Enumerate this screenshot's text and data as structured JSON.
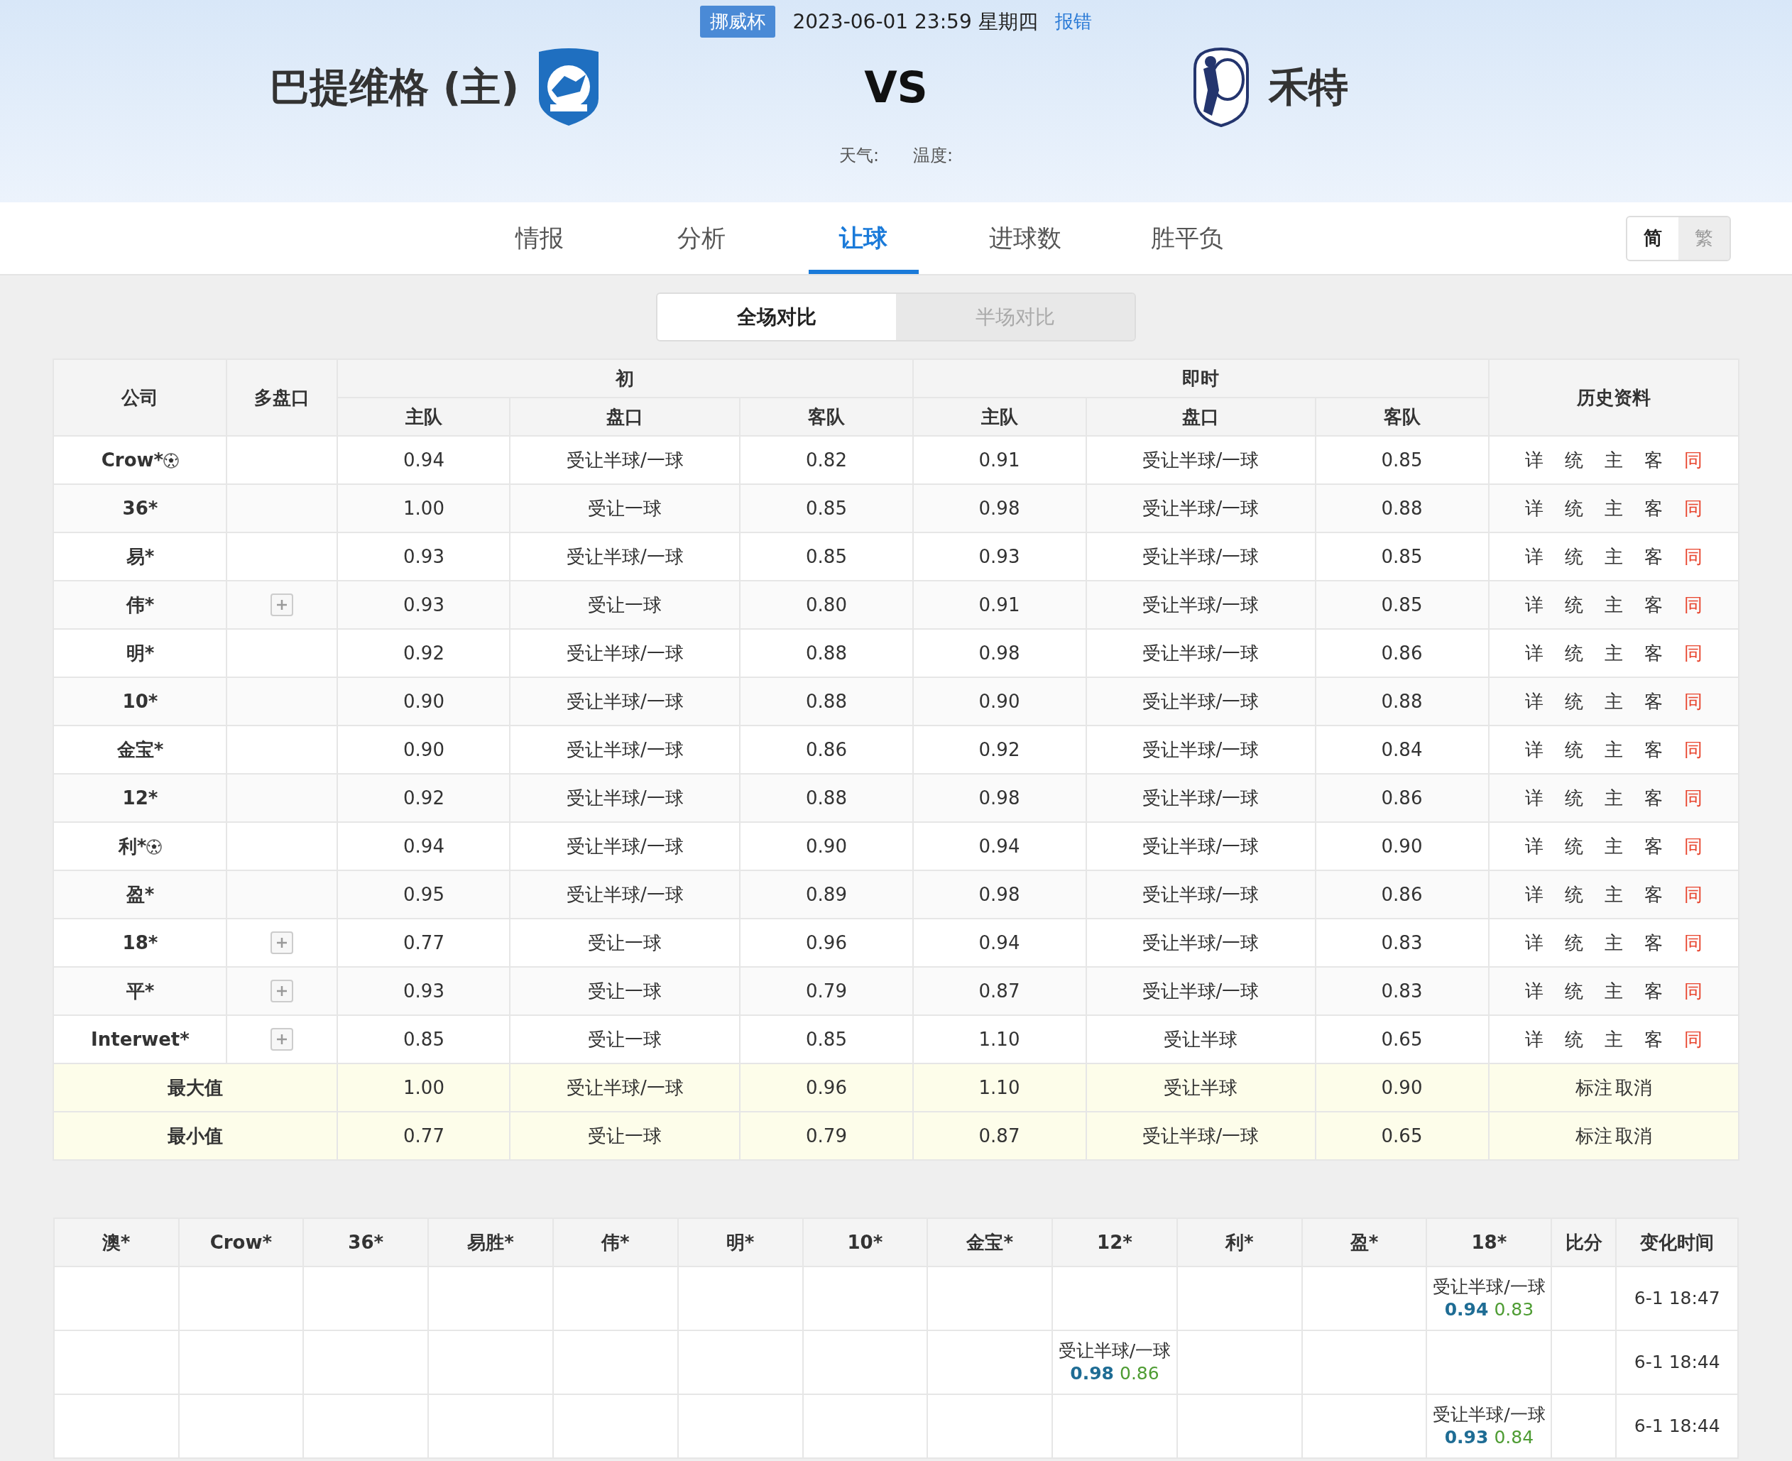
{
  "match": {
    "competition": "挪威杯",
    "datetime": "2023-06-01 23:59 星期四",
    "report_link": "报错",
    "home_team": "巴提维格 (主)",
    "vs": "VS",
    "away_team": "禾特",
    "weather_label": "天气:",
    "temperature_label": "温度:"
  },
  "tabs": [
    {
      "label": "情报",
      "selected": false
    },
    {
      "label": "分析",
      "selected": false
    },
    {
      "label": "让球",
      "selected": true
    },
    {
      "label": "进球数",
      "selected": false
    },
    {
      "label": "胜平负",
      "selected": false
    }
  ],
  "script_toggle": [
    {
      "label": "简",
      "selected": true
    },
    {
      "label": "繁",
      "selected": false
    }
  ],
  "compare_toggle": [
    {
      "label": "全场对比",
      "selected": true
    },
    {
      "label": "半场对比",
      "selected": false
    }
  ],
  "odds_table": {
    "company_header": "公司",
    "multi_header": "多盘口",
    "initial_header": "初",
    "live_header": "即时",
    "history_header": "历史资料",
    "sub_headers": [
      "主队",
      "盘口",
      "客队",
      "主队",
      "盘口",
      "客队"
    ],
    "rows": [
      {
        "company": "Crow*",
        "ball_icon": true,
        "multi_line": false,
        "initial": [
          "0.94",
          "受让半球/一球",
          "0.82"
        ],
        "live": [
          "0.91",
          "受让半球/一球",
          "0.85"
        ],
        "history": [
          {
            "label": "详",
            "color": "#333333"
          },
          {
            "label": "统",
            "color": "#333333"
          },
          {
            "label": "主",
            "color": "#333333"
          },
          {
            "label": "客",
            "color": "#333333"
          },
          {
            "label": "同",
            "color": "#e8462f"
          }
        ]
      },
      {
        "company": "36*",
        "ball_icon": false,
        "multi_line": false,
        "initial": [
          "1.00",
          "受让一球",
          "0.85"
        ],
        "live": [
          "0.98",
          "受让半球/一球",
          "0.88"
        ],
        "history": [
          {
            "label": "详",
            "color": "#333333"
          },
          {
            "label": "统",
            "color": "#333333"
          },
          {
            "label": "主",
            "color": "#333333"
          },
          {
            "label": "客",
            "color": "#333333"
          },
          {
            "label": "同",
            "color": "#e8462f"
          }
        ]
      },
      {
        "company": "易*",
        "ball_icon": false,
        "multi_line": false,
        "initial": [
          "0.93",
          "受让半球/一球",
          "0.85"
        ],
        "live": [
          "0.93",
          "受让半球/一球",
          "0.85"
        ],
        "history": [
          {
            "label": "详",
            "color": "#333333"
          },
          {
            "label": "统",
            "color": "#333333"
          },
          {
            "label": "主",
            "color": "#333333"
          },
          {
            "label": "客",
            "color": "#333333"
          },
          {
            "label": "同",
            "color": "#e8462f"
          }
        ]
      },
      {
        "company": "伟*",
        "ball_icon": false,
        "multi_line": true,
        "initial": [
          "0.93",
          "受让一球",
          "0.80"
        ],
        "live": [
          "0.91",
          "受让半球/一球",
          "0.85"
        ],
        "history": [
          {
            "label": "详",
            "color": "#333333"
          },
          {
            "label": "统",
            "color": "#333333"
          },
          {
            "label": "主",
            "color": "#333333"
          },
          {
            "label": "客",
            "color": "#333333"
          },
          {
            "label": "同",
            "color": "#e8462f"
          }
        ]
      },
      {
        "company": "明*",
        "ball_icon": false,
        "multi_line": false,
        "initial": [
          "0.92",
          "受让半球/一球",
          "0.88"
        ],
        "live": [
          "0.98",
          "受让半球/一球",
          "0.86"
        ],
        "history": [
          {
            "label": "详",
            "color": "#333333"
          },
          {
            "label": "统",
            "color": "#333333"
          },
          {
            "label": "主",
            "color": "#333333"
          },
          {
            "label": "客",
            "color": "#333333"
          },
          {
            "label": "同",
            "color": "#e8462f"
          }
        ]
      },
      {
        "company": "10*",
        "ball_icon": false,
        "multi_line": false,
        "initial": [
          "0.90",
          "受让半球/一球",
          "0.88"
        ],
        "live": [
          "0.90",
          "受让半球/一球",
          "0.88"
        ],
        "history": [
          {
            "label": "详",
            "color": "#333333"
          },
          {
            "label": "统",
            "color": "#333333"
          },
          {
            "label": "主",
            "color": "#333333"
          },
          {
            "label": "客",
            "color": "#333333"
          },
          {
            "label": "同",
            "color": "#e8462f"
          }
        ]
      },
      {
        "company": "金宝*",
        "ball_icon": false,
        "multi_line": false,
        "initial": [
          "0.90",
          "受让半球/一球",
          "0.86"
        ],
        "live": [
          "0.92",
          "受让半球/一球",
          "0.84"
        ],
        "history": [
          {
            "label": "详",
            "color": "#333333"
          },
          {
            "label": "统",
            "color": "#333333"
          },
          {
            "label": "主",
            "color": "#333333"
          },
          {
            "label": "客",
            "color": "#333333"
          },
          {
            "label": "同",
            "color": "#e8462f"
          }
        ]
      },
      {
        "company": "12*",
        "ball_icon": false,
        "multi_line": false,
        "initial": [
          "0.92",
          "受让半球/一球",
          "0.88"
        ],
        "live": [
          "0.98",
          "受让半球/一球",
          "0.86"
        ],
        "history": [
          {
            "label": "详",
            "color": "#333333"
          },
          {
            "label": "统",
            "color": "#333333"
          },
          {
            "label": "主",
            "color": "#333333"
          },
          {
            "label": "客",
            "color": "#333333"
          },
          {
            "label": "同",
            "color": "#e8462f"
          }
        ]
      },
      {
        "company": "利*",
        "ball_icon": true,
        "multi_line": false,
        "initial": [
          "0.94",
          "受让半球/一球",
          "0.90"
        ],
        "live": [
          "0.94",
          "受让半球/一球",
          "0.90"
        ],
        "history": [
          {
            "label": "详",
            "color": "#333333"
          },
          {
            "label": "统",
            "color": "#333333"
          },
          {
            "label": "主",
            "color": "#333333"
          },
          {
            "label": "客",
            "color": "#333333"
          },
          {
            "label": "同",
            "color": "#e8462f"
          }
        ]
      },
      {
        "company": "盈*",
        "ball_icon": false,
        "multi_line": false,
        "initial": [
          "0.95",
          "受让半球/一球",
          "0.89"
        ],
        "live": [
          "0.98",
          "受让半球/一球",
          "0.86"
        ],
        "history": [
          {
            "label": "详",
            "color": "#333333"
          },
          {
            "label": "统",
            "color": "#333333"
          },
          {
            "label": "主",
            "color": "#333333"
          },
          {
            "label": "客",
            "color": "#333333"
          },
          {
            "label": "同",
            "color": "#e8462f"
          }
        ]
      },
      {
        "company": "18*",
        "ball_icon": false,
        "multi_line": true,
        "initial": [
          "0.77",
          "受让一球",
          "0.96"
        ],
        "live": [
          "0.94",
          "受让半球/一球",
          "0.83"
        ],
        "history": [
          {
            "label": "详",
            "color": "#333333"
          },
          {
            "label": "统",
            "color": "#333333"
          },
          {
            "label": "主",
            "color": "#333333"
          },
          {
            "label": "客",
            "color": "#333333"
          },
          {
            "label": "同",
            "color": "#e8462f"
          }
        ]
      },
      {
        "company": "平*",
        "ball_icon": false,
        "multi_line": true,
        "initial": [
          "0.93",
          "受让一球",
          "0.79"
        ],
        "live": [
          "0.87",
          "受让半球/一球",
          "0.83"
        ],
        "history": [
          {
            "label": "详",
            "color": "#333333"
          },
          {
            "label": "统",
            "color": "#333333"
          },
          {
            "label": "主",
            "color": "#333333"
          },
          {
            "label": "客",
            "color": "#333333"
          },
          {
            "label": "同",
            "color": "#e8462f"
          }
        ]
      },
      {
        "company": "Interwet*",
        "ball_icon": false,
        "multi_line": true,
        "initial": [
          "0.85",
          "受让一球",
          "0.85"
        ],
        "live": [
          "1.10",
          "受让半球",
          "0.65"
        ],
        "history": [
          {
            "label": "详",
            "color": "#333333"
          },
          {
            "label": "统",
            "color": "#333333"
          },
          {
            "label": "主",
            "color": "#333333"
          },
          {
            "label": "客",
            "color": "#333333"
          },
          {
            "label": "同",
            "color": "#e8462f"
          }
        ]
      }
    ],
    "summary_rows": [
      {
        "label": "最大值",
        "initial": [
          "1.00",
          "受让半球/一球",
          "0.96"
        ],
        "live": [
          "1.10",
          "受让半球",
          "0.90"
        ],
        "actions": [
          "标注",
          "取消"
        ]
      },
      {
        "label": "最小值",
        "initial": [
          "0.77",
          "受让一球",
          "0.79"
        ],
        "live": [
          "0.87",
          "受让半球/一球",
          "0.65"
        ],
        "actions": [
          "标注",
          "取消"
        ]
      }
    ]
  },
  "changes_table": {
    "columns": [
      "澳*",
      "Crow*",
      "36*",
      "易胜*",
      "伟*",
      "明*",
      "10*",
      "金宝*",
      "12*",
      "利*",
      "盈*",
      "18*",
      "比分",
      "变化时间"
    ],
    "rows": [
      {
        "cells": [
          null,
          null,
          null,
          null,
          null,
          null,
          null,
          null,
          null,
          null,
          null,
          {
            "line": "受让半球/一球",
            "home": "0.94",
            "away": "0.83"
          },
          null
        ],
        "time": "6-1 18:47"
      },
      {
        "cells": [
          null,
          null,
          null,
          null,
          null,
          null,
          null,
          null,
          {
            "line": "受让半球/一球",
            "home": "0.98",
            "away": "0.86"
          },
          null,
          null,
          null,
          null
        ],
        "time": "6-1 18:44"
      },
      {
        "cells": [
          null,
          null,
          null,
          null,
          null,
          null,
          null,
          null,
          null,
          null,
          null,
          {
            "line": "受让半球/一球",
            "home": "0.93",
            "away": "0.84"
          },
          null
        ],
        "time": "6-1 18:44"
      }
    ]
  }
}
